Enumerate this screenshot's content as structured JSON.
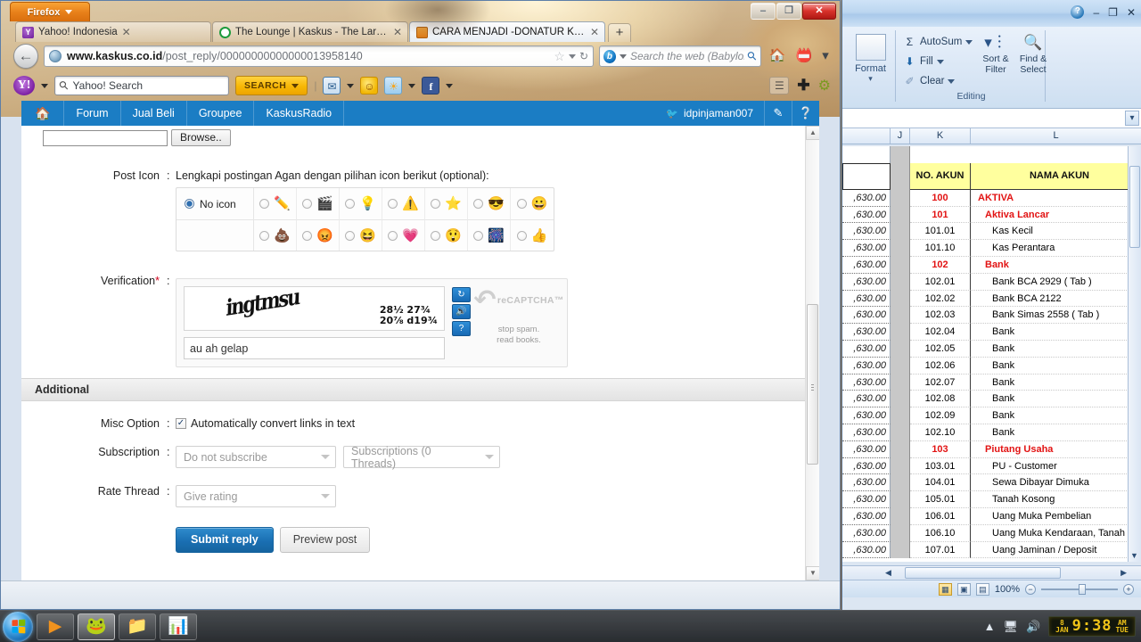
{
  "browser": {
    "app_button": "Firefox",
    "tabs": [
      {
        "title": "Yahoo! Indonesia",
        "favicon": "yahoo-icon",
        "active": false
      },
      {
        "title": "The Lounge | Kaskus - The Largest In...",
        "favicon": "kaskus-icon",
        "active": false
      },
      {
        "title": "CARA MENJADI -DONATUR KASKUS-...",
        "favicon": "kaskus-orange-icon",
        "active": true
      }
    ],
    "new_tab_label": "+",
    "url": {
      "domain": "www.kaskus.co.id",
      "path": "/post_reply/00000000000000013958140"
    },
    "search": {
      "engine": "b",
      "placeholder": "Search the web (Babylon)"
    },
    "window_controls": {
      "minimize": "–",
      "maximize": "❐",
      "close": "✕"
    },
    "yahoo_toolbar": {
      "logo": "Y!",
      "search_value": "Yahoo! Search",
      "search_button": "SEARCH",
      "icons": [
        "mail-icon",
        "messenger-icon",
        "weather-icon",
        "facebook-icon"
      ],
      "right_icons": [
        "list-icon",
        "plus-icon",
        "gear-icon"
      ]
    }
  },
  "kaskus_nav": {
    "home_icon": "home-icon",
    "items": [
      "Forum",
      "Jual Beli",
      "Groupee",
      "KaskusRadio"
    ],
    "username": "idpinjaman007",
    "right_icons": [
      "pencil-icon",
      "help-icon"
    ]
  },
  "form": {
    "attachment": {
      "value": "",
      "browse_label": "Browse.."
    },
    "post_icon": {
      "label": "Post Icon",
      "colon": ":",
      "description": "Lengkapi postingan Agan dengan pilihan icon berikut (optional):",
      "no_icon_label": "No icon",
      "no_icon_selected": true,
      "row1": [
        {
          "name": "pencil-icon",
          "glyph": "✏️"
        },
        {
          "name": "clapperboard-icon",
          "glyph": "🎬"
        },
        {
          "name": "lightbulb-icon",
          "glyph": "💡"
        },
        {
          "name": "warning-icon",
          "glyph": "⚠️"
        },
        {
          "name": "star-icon",
          "glyph": "⭐"
        },
        {
          "name": "cool-smiley-icon",
          "glyph": "😎"
        },
        {
          "name": "yellow-smiley-icon",
          "glyph": "😀"
        }
      ],
      "row2": [
        {
          "name": "poop-icon",
          "glyph": "💩"
        },
        {
          "name": "angry-smiley-icon",
          "glyph": "😡"
        },
        {
          "name": "laughing-smiley-icon",
          "glyph": "😆"
        },
        {
          "name": "heart-icon",
          "glyph": "💗"
        },
        {
          "name": "blue-smiley-icon",
          "glyph": "😲"
        },
        {
          "name": "firework-icon",
          "glyph": "🎆"
        },
        {
          "name": "thumbs-up-icon",
          "glyph": "👍"
        }
      ]
    },
    "verification": {
      "label": "Verification",
      "required_mark": "*",
      "colon": ":",
      "captcha_word": "ingtmsu",
      "captcha_numbers_line1": "28½  27¾",
      "captcha_numbers_line2": "20⅞ d19¾",
      "input_value": "au ah gelap",
      "buttons": [
        "refresh-icon",
        "audio-icon",
        "help-icon"
      ],
      "brand": "reCAPTCHA™",
      "tagline_line1": "stop spam.",
      "tagline_line2": "read books."
    },
    "additional_section_title": "Additional",
    "misc_option": {
      "label": "Misc Option",
      "colon": ":",
      "checkbox_label": "Automatically convert links in text",
      "checked": true
    },
    "subscription": {
      "label": "Subscription",
      "colon": ":",
      "select1": "Do not subscribe",
      "select2": "Subscriptions (0 Threads)"
    },
    "rate_thread": {
      "label": "Rate Thread",
      "colon": ":",
      "select": "Give rating"
    },
    "submit_label": "Submit reply",
    "preview_label": "Preview post"
  },
  "excel": {
    "help_icon": "help-icon",
    "window_controls": {
      "minimize": "–",
      "restore": "❐",
      "close": "✕"
    },
    "ribbon": {
      "cells_group": {
        "format_label": "Format",
        "icon": "format-table-icon"
      },
      "editing_group": {
        "name": "Editing",
        "items": [
          {
            "glyph": "Σ",
            "label": "AutoSum",
            "has_caret": true
          },
          {
            "glyph": "⬇",
            "label": "Fill",
            "has_caret": true
          },
          {
            "glyph": "✐",
            "label": "Clear",
            "has_caret": true
          }
        ],
        "sort_filter": {
          "label_line1": "Sort &",
          "label_line2": "Filter",
          "icon": "sort-filter-icon"
        },
        "find_select": {
          "label_line1": "Find &",
          "label_line2": "Select",
          "icon": "find-select-icon"
        }
      }
    },
    "columns": [
      "J",
      "K",
      "L"
    ],
    "table_headers": {
      "no_akun": "NO. AKUN",
      "nama_akun": "NAMA AKUN"
    },
    "left_column_value": ",630.00",
    "rows": [
      {
        "no": "100",
        "nama": "AKTIVA",
        "red": true,
        "indent": 0
      },
      {
        "no": "101",
        "nama": "Aktiva Lancar",
        "red": true,
        "indent": 1
      },
      {
        "no": "101.01",
        "nama": "Kas Kecil",
        "red": false,
        "indent": 2
      },
      {
        "no": "101.10",
        "nama": "Kas Perantara",
        "red": false,
        "indent": 2
      },
      {
        "no": "102",
        "nama": "Bank",
        "red": true,
        "indent": 1
      },
      {
        "no": "102.01",
        "nama": "Bank BCA 2929 ( Tab )",
        "red": false,
        "indent": 2
      },
      {
        "no": "102.02",
        "nama": "Bank BCA 2122",
        "red": false,
        "indent": 2
      },
      {
        "no": "102.03",
        "nama": "Bank Simas 2558 ( Tab )",
        "red": false,
        "indent": 2
      },
      {
        "no": "102.04",
        "nama": "Bank",
        "red": false,
        "indent": 2
      },
      {
        "no": "102.05",
        "nama": "Bank",
        "red": false,
        "indent": 2
      },
      {
        "no": "102.06",
        "nama": "Bank",
        "red": false,
        "indent": 2
      },
      {
        "no": "102.07",
        "nama": "Bank",
        "red": false,
        "indent": 2
      },
      {
        "no": "102.08",
        "nama": "Bank",
        "red": false,
        "indent": 2
      },
      {
        "no": "102.09",
        "nama": "Bank",
        "red": false,
        "indent": 2
      },
      {
        "no": "102.10",
        "nama": "Bank",
        "red": false,
        "indent": 2
      },
      {
        "no": "103",
        "nama": "Piutang Usaha",
        "red": true,
        "indent": 1
      },
      {
        "no": "103.01",
        "nama": "PU - Customer",
        "red": false,
        "indent": 2
      },
      {
        "no": "104.01",
        "nama": "Sewa Dibayar Dimuka",
        "red": false,
        "indent": 2
      },
      {
        "no": "105.01",
        "nama": "Tanah Kosong",
        "red": false,
        "indent": 2
      },
      {
        "no": "106.01",
        "nama": "Uang Muka Pembelian",
        "red": false,
        "indent": 2
      },
      {
        "no": "106.10",
        "nama": "Uang Muka Kendaraan, Tanah & Bangu",
        "red": false,
        "indent": 2
      },
      {
        "no": "107.01",
        "nama": "Uang Jaminan / Deposit",
        "red": false,
        "indent": 2
      }
    ],
    "status": {
      "zoom": "100%",
      "views": [
        "normal-view-icon",
        "page-layout-icon",
        "page-break-icon"
      ]
    }
  },
  "taskbar": {
    "start": "start-orb",
    "buttons": [
      {
        "name": "media-player",
        "glyph": "▶"
      },
      {
        "name": "firefox",
        "glyph": "🦊",
        "active": true
      },
      {
        "name": "explorer",
        "glyph": "📁"
      },
      {
        "name": "excel",
        "glyph": "📊"
      }
    ],
    "tray_icons": [
      "show-hidden-icon",
      "network-icon",
      "volume-icon"
    ],
    "clock": {
      "day": "8",
      "month": "JAN",
      "time": "9:38",
      "ampm": "AM",
      "weekday": "TUE"
    }
  },
  "colors": {
    "kaskus_blue": "#1b7dc4",
    "firefox_orange": "#e8801a",
    "excel_red": "#e21313",
    "header_yellow": "#ffff9e"
  }
}
